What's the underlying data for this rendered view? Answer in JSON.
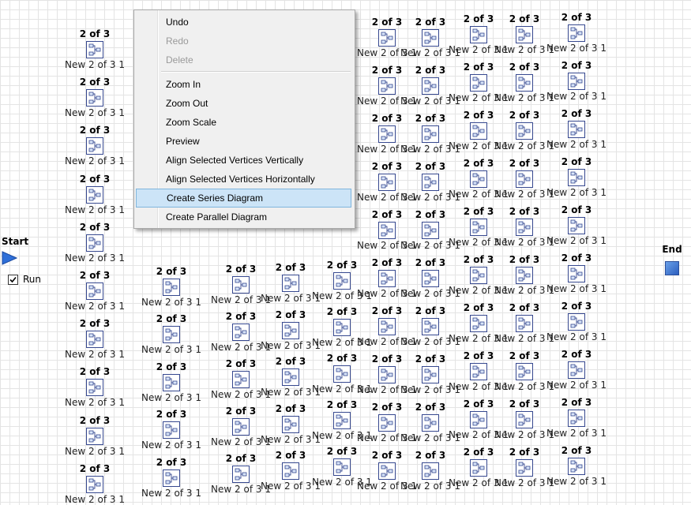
{
  "canvas": {
    "start_label": "Start",
    "end_label": "End",
    "run_label": "Run",
    "run_checked": true,
    "colors": {
      "icon_border": "#36488f",
      "start_arrow": "#2e6fd8",
      "menu_highlight": "#cce4f7"
    }
  },
  "node_template": {
    "title": "2 of 3",
    "subtitle": "New 2 of 3 1",
    "icon": "series-diagram-node-icon"
  },
  "nodes": {
    "columns": [
      {
        "rows": 10,
        "title_first": 43,
        "title_step": 61.2,
        "clip_left": false
      },
      {
        "rows": 6,
        "title_first": 344,
        "title_step": 60.4,
        "clip_left": false
      },
      {
        "rows": 6,
        "title_first": 341,
        "title_step": 60,
        "clip_left": false
      },
      {
        "rows": 6,
        "title_first": 339,
        "title_step": 59.6,
        "clip_left": false
      },
      {
        "rows": 6,
        "title_first": 336,
        "title_step": 59,
        "clip_left": false
      },
      {
        "rows": 10,
        "title_first": 28,
        "title_step": 61,
        "clip_left": true
      },
      {
        "rows": 10,
        "title_first": 28,
        "title_step": 61,
        "clip_left": true
      },
      {
        "rows": 10,
        "title_first": 24,
        "title_step": 61,
        "clip_left": true
      },
      {
        "rows": 10,
        "title_first": 24,
        "title_step": 61,
        "clip_left": true
      },
      {
        "rows": 10,
        "title_first": 22,
        "title_step": 61,
        "clip_left": true
      }
    ],
    "partial_subtitles": [
      {
        "text": "New 2 of 3 1"
      },
      {
        "text": "New 2 of 3"
      },
      {
        "text": "New 2 of 3"
      },
      {
        "text": "New 2 of 3"
      },
      {
        "text": "New 2 of"
      },
      {
        "text": "New 2 of 3"
      }
    ]
  },
  "context_menu": {
    "items": [
      {
        "label": "Undo",
        "enabled": true
      },
      {
        "label": "Redo",
        "enabled": false
      },
      {
        "label": "Delete",
        "enabled": false
      },
      {
        "separator": true
      },
      {
        "label": "Zoom In",
        "enabled": true
      },
      {
        "label": "Zoom Out",
        "enabled": true
      },
      {
        "label": "Zoom Scale",
        "enabled": true
      },
      {
        "label": "Preview",
        "enabled": true
      },
      {
        "label": "Align Selected Vertices Vertically",
        "enabled": true
      },
      {
        "label": "Align Selected Vertices Horizontally",
        "enabled": true
      },
      {
        "label": "Create Series Diagram",
        "enabled": true,
        "highlighted": true
      },
      {
        "label": "Create Parallel Diagram",
        "enabled": true
      }
    ]
  }
}
